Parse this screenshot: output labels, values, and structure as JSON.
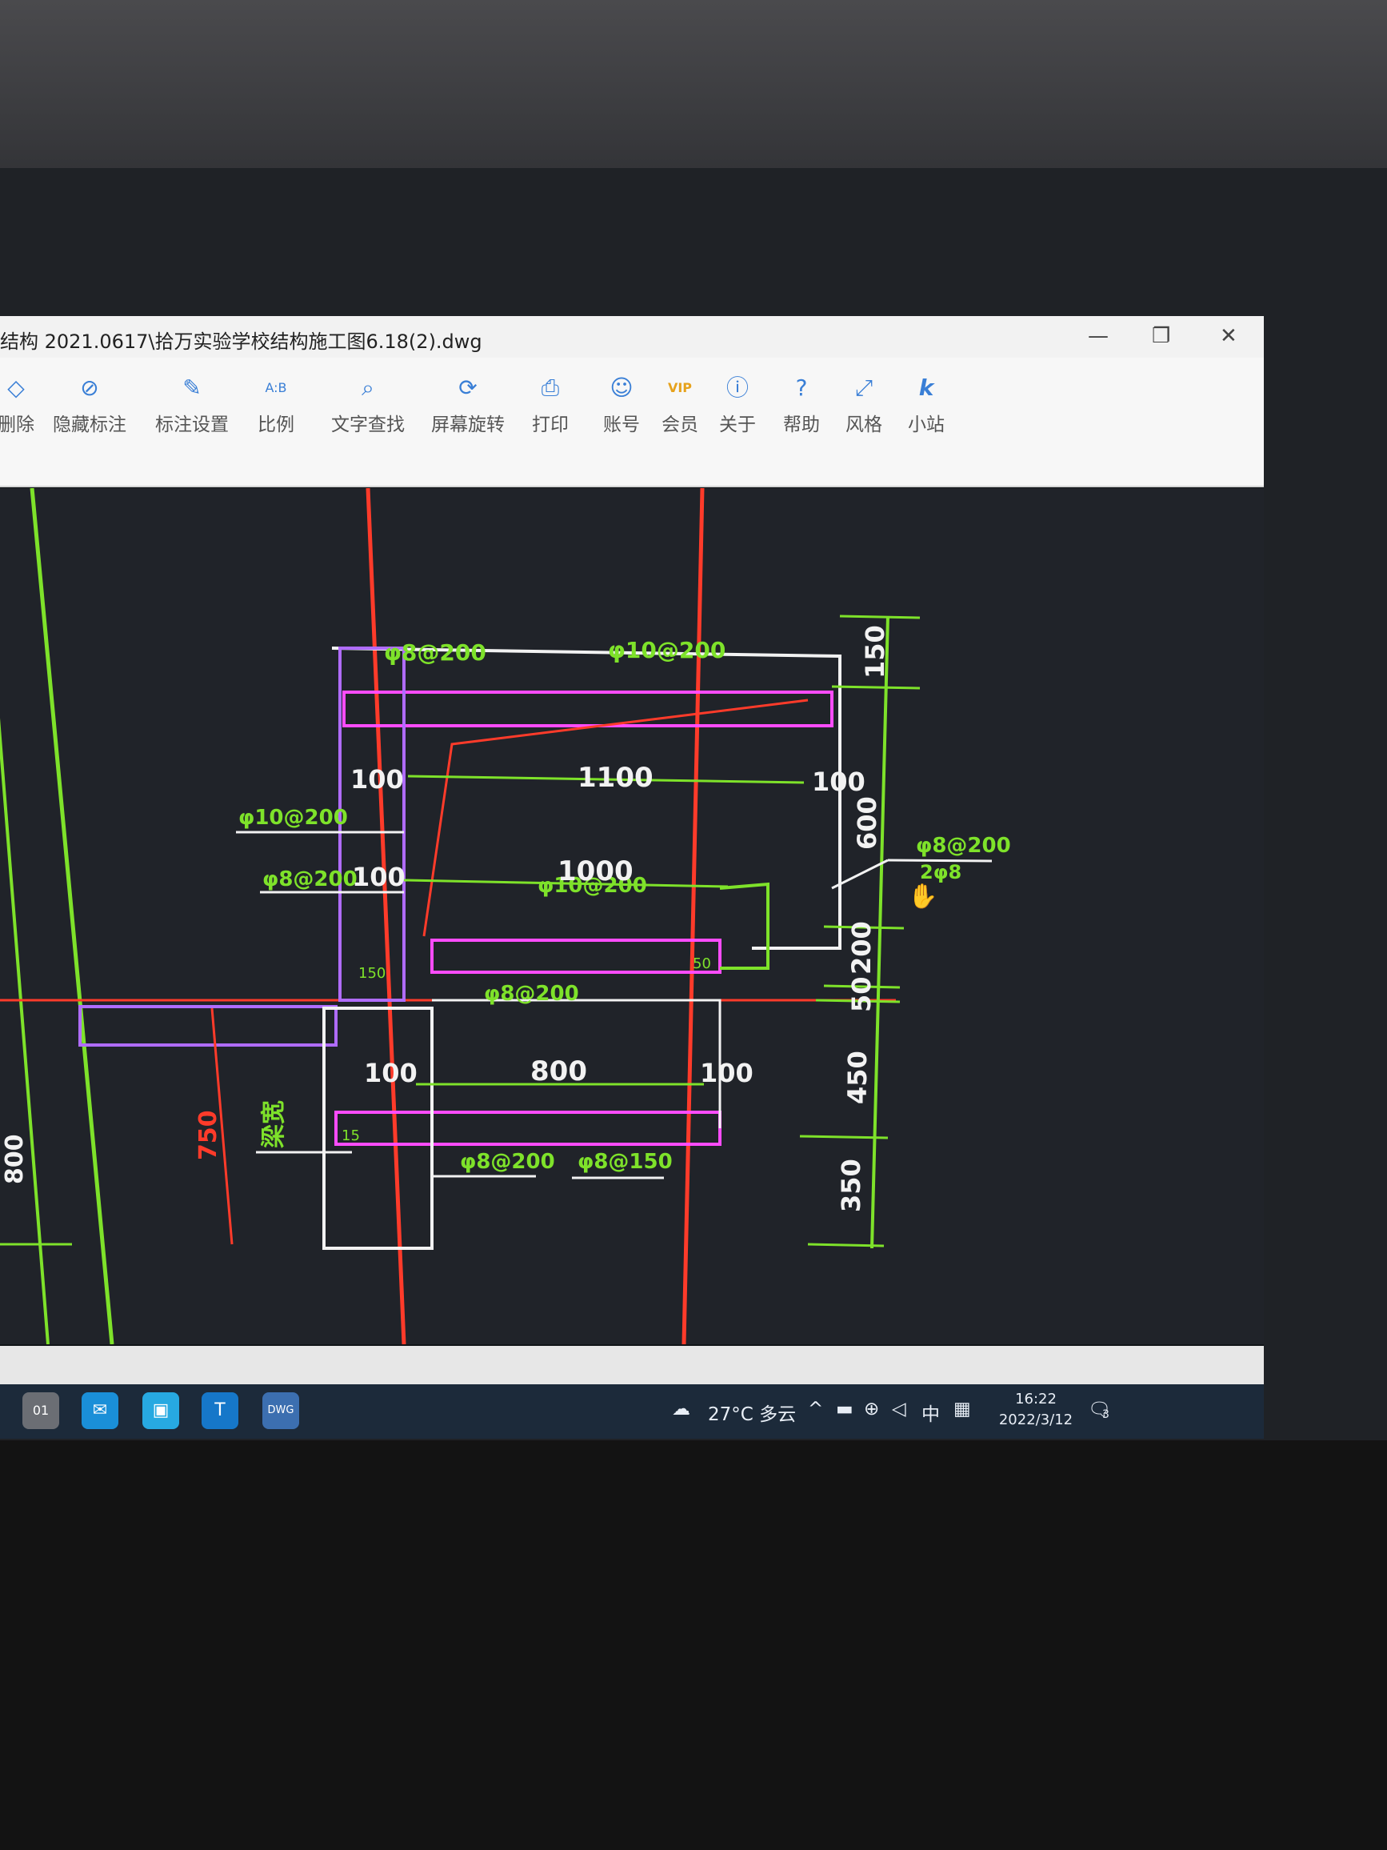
{
  "window": {
    "title": "结构 2021.0617\\拾万实验学校结构施工图6.18(2).dwg",
    "controls": {
      "minimize": "—",
      "maximize": "❐",
      "close": "✕"
    }
  },
  "toolbar": {
    "items": [
      {
        "label": "删除",
        "icon": "eraser-icon"
      },
      {
        "label": "隐藏标注",
        "icon": "eye-slash-icon"
      },
      {
        "label": "标注设置",
        "icon": "annotation-settings-icon"
      },
      {
        "label": "比例",
        "icon": "scale-ruler-icon"
      },
      {
        "label": "文字查找",
        "icon": "text-search-icon"
      },
      {
        "label": "屏幕旋转",
        "icon": "rotate-screen-icon"
      },
      {
        "label": "打印",
        "icon": "printer-icon"
      },
      {
        "label": "账号",
        "icon": "user-icon"
      },
      {
        "label": "会员",
        "icon": "vip-icon"
      },
      {
        "label": "关于",
        "icon": "info-icon"
      },
      {
        "label": "帮助",
        "icon": "help-icon"
      },
      {
        "label": "风格",
        "icon": "style-icon"
      },
      {
        "label": "小站",
        "icon": "k-logo-icon"
      }
    ],
    "vip_text": "VIP",
    "ab_text": "A:B"
  },
  "drawing": {
    "rebar_labels": [
      "φ8@200",
      "φ10@200",
      "φ10@200",
      "φ8@200",
      "φ10@200",
      "φ8@200",
      "φ8@200",
      "φ8@150",
      "φ8@200",
      "2φ8"
    ],
    "dims": {
      "top": "1100",
      "left_top": "100",
      "right_top": "100",
      "mid": "1000",
      "left_mid": "100",
      "bottom": "800",
      "left_bot": "100",
      "right_bot": "100",
      "side_left": "750",
      "far_left": "800",
      "small1": "150",
      "small2": "50",
      "small3": "15"
    },
    "vertical_dims": [
      "150",
      "600",
      "200",
      "50",
      "450",
      "350"
    ],
    "beam_text": "梁宽"
  },
  "taskbar": {
    "weather": "27°C 多云",
    "ime": "中",
    "time": "16:22",
    "date": "2022/3/12",
    "notif": "3",
    "app_labels": {
      "app1": "01",
      "app2": "T",
      "app3": "DWG"
    }
  },
  "colors": {
    "accent": "#3a7fd6",
    "green": "#7ee22a",
    "red": "#ff3b2a",
    "purple": "#b06cff",
    "magenta": "#ff4cff",
    "white": "#f2f2f2"
  }
}
